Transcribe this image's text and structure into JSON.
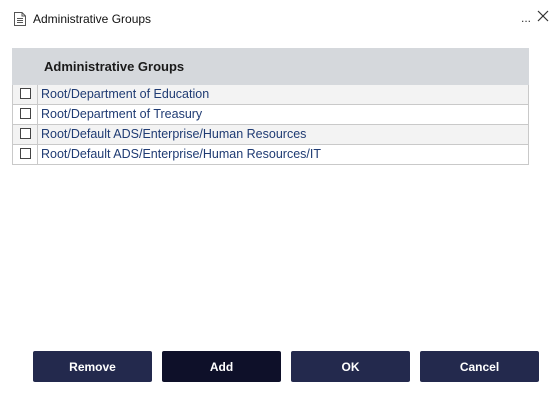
{
  "window": {
    "title": "Administrative Groups",
    "menu_label": "...",
    "close_label": "close"
  },
  "table": {
    "header": "Administrative Groups",
    "rows": [
      {
        "label": "Root/Department of Education",
        "checked": false
      },
      {
        "label": "Root/Department of Treasury",
        "checked": false
      },
      {
        "label": "Root/Default ADS/Enterprise/Human Resources",
        "checked": false
      },
      {
        "label": "Root/Default ADS/Enterprise/Human Resources/IT",
        "checked": false
      }
    ]
  },
  "buttons": {
    "remove": "Remove",
    "add": "Add",
    "ok": "OK",
    "cancel": "Cancel"
  },
  "colors": {
    "button": "#23294d",
    "button_active": "#0e1029",
    "header_bg": "#d5d8dc",
    "link_text": "#1f3b73"
  }
}
